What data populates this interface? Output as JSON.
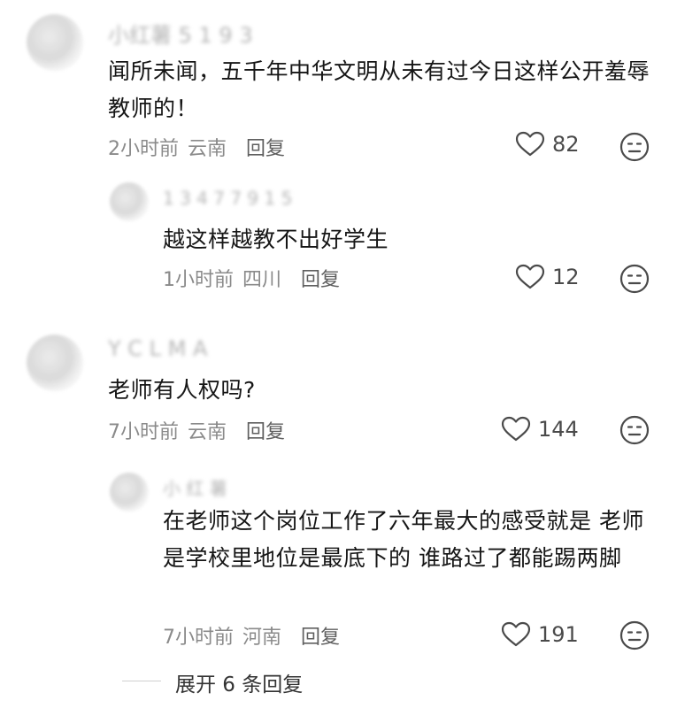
{
  "comments": [
    {
      "username": "小红薯 5 1 9 3",
      "text": "闻所未闻，五千年中华文明从未有过今日这样公开羞辱教师的！",
      "time": "2小时前",
      "location": "云南",
      "reply_label": "回复",
      "likes": "82"
    },
    {
      "username": "1 3 4 7 7 9 1 5",
      "text": "越这样越教不出好学生",
      "time": "1小时前",
      "location": "四川",
      "reply_label": "回复",
      "likes": "12"
    },
    {
      "username": "Y C L M A",
      "text": "老师有人权吗?",
      "time": "7小时前",
      "location": "云南",
      "reply_label": "回复",
      "likes": "144"
    },
    {
      "username": "小 红 薯",
      "text": "在老师这个岗位工作了六年最大的感受就是 老师是学校里地位是最底下的 谁路过了都能踢两脚",
      "time": "7小时前",
      "location": "河南",
      "reply_label": "回复",
      "likes": "191"
    }
  ],
  "expand_replies": "展开 6 条回复",
  "icons": {
    "like": "heart-outline-icon",
    "dislike": "neutral-face-icon"
  },
  "colors": {
    "text": "#161616",
    "meta": "#8a8a8a",
    "icon": "#4a4a4a"
  }
}
